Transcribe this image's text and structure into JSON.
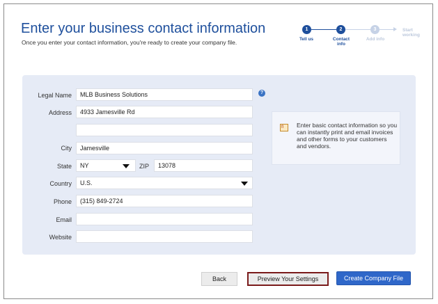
{
  "header": {
    "title": "Enter your business contact information",
    "subtitle": "Once you enter your contact information, you're ready to create your company file."
  },
  "steps": [
    {
      "number": "1",
      "label": "Tell us",
      "state": "active"
    },
    {
      "number": "2",
      "label": "Contact info",
      "state": "active"
    },
    {
      "number": "3",
      "label": "Add info",
      "state": "inactive"
    },
    {
      "number": "",
      "label": "Start working",
      "state": "inactive"
    }
  ],
  "form": {
    "legal_name": {
      "label": "Legal Name",
      "value": "MLB Business Solutions"
    },
    "address": {
      "label": "Address",
      "value": "4933 Jamesville Rd",
      "line2": ""
    },
    "city": {
      "label": "City",
      "value": "Jamesville"
    },
    "state": {
      "label": "State",
      "value": "NY"
    },
    "zip": {
      "label": "ZIP",
      "value": "13078"
    },
    "country": {
      "label": "Country",
      "value": "U.S."
    },
    "phone": {
      "label": "Phone",
      "value": "(315) 849-2724"
    },
    "email": {
      "label": "Email",
      "value": ""
    },
    "website": {
      "label": "Website",
      "value": ""
    }
  },
  "tip": {
    "text": "Enter basic contact information so you can instantly print and email invoices and other forms to your customers and vendors."
  },
  "buttons": {
    "back": "Back",
    "preview": "Preview Your Settings",
    "create": "Create Company File"
  },
  "colors": {
    "accent": "#1e4f9c",
    "panel": "#e6ebf6",
    "primary_button": "#2f67c9",
    "focus_outline": "#7a1a1a"
  }
}
